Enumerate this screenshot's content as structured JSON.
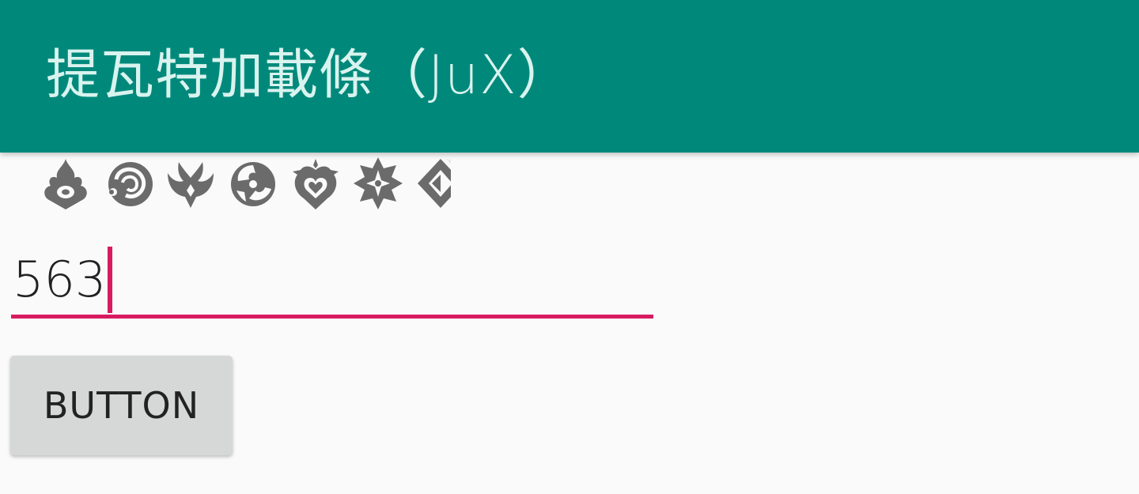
{
  "app_bar": {
    "title": "提瓦特加載條（JuX）",
    "background": "#00897b",
    "title_color": "#d9f3ee"
  },
  "element_icons": [
    {
      "name": "pyro-icon"
    },
    {
      "name": "hydro-icon"
    },
    {
      "name": "anemo-icon"
    },
    {
      "name": "electro-icon"
    },
    {
      "name": "dendro-icon"
    },
    {
      "name": "cryo-icon"
    },
    {
      "name": "geo-icon",
      "partially_revealed": true
    }
  ],
  "icon_color": "#6b6b6b",
  "input": {
    "value": "563",
    "accent_color": "#d81b60",
    "focused": true
  },
  "button": {
    "label": "BUTTON"
  }
}
